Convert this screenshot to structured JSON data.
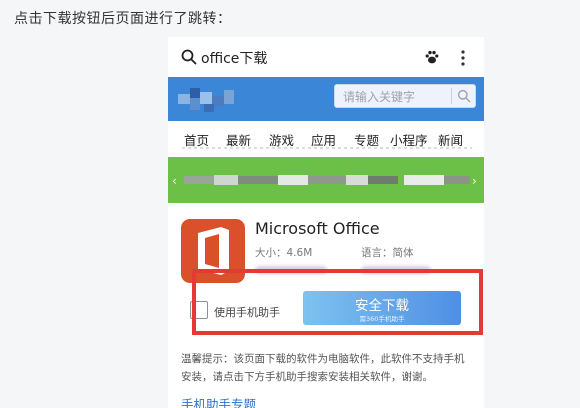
{
  "caption": "点击下载按钮后页面进行了跳转：",
  "topbar": {
    "query": "office下载",
    "icons": [
      "search-icon",
      "paw-icon",
      "more-vertical-icon"
    ]
  },
  "header": {
    "search_placeholder": "请输入关键字",
    "colors": {
      "header": "#3b86d6",
      "banner": "#6cbf47",
      "highlight": "#e53935",
      "link": "#2a6fc9"
    }
  },
  "nav": {
    "items": [
      "首页",
      "最新",
      "游戏",
      "应用",
      "专题",
      "小程序",
      "新闻"
    ]
  },
  "app": {
    "name": "Microsoft Office",
    "size_label": "大小：4.6M",
    "language_label": "语言：简体"
  },
  "download": {
    "checkbox_label": "使用手机助手",
    "checkbox_checked": false,
    "button_label": "安全下载",
    "button_sub": "需360手机助手"
  },
  "tip": {
    "text": "温馨提示：该页面下载的软件为电脑软件，此软件不支持手机安装，请点击下方手机助手搜索安装相关软件，谢谢。"
  },
  "section": {
    "title": "手机助手专题"
  }
}
